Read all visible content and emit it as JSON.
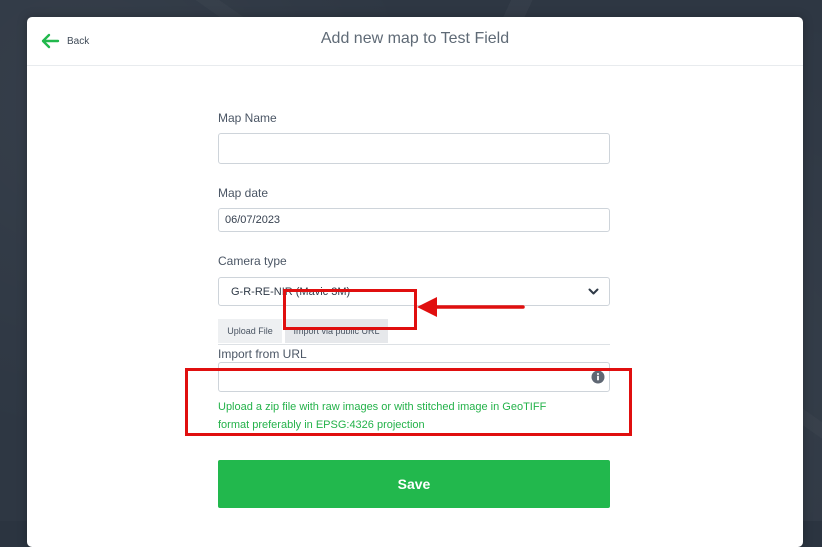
{
  "header": {
    "back_label": "Back",
    "title": "Add new map to Test Field"
  },
  "form": {
    "map_name": {
      "label": "Map Name",
      "value": ""
    },
    "map_date": {
      "label": "Map date",
      "value": "06/07/2023"
    },
    "camera_type": {
      "label": "Camera type",
      "selected": "G-R-RE-NIR (Mavic 3M)"
    },
    "tabs": [
      {
        "label": "Upload File",
        "active": false
      },
      {
        "label": "Import via public URL",
        "active": true
      }
    ],
    "import_url": {
      "label": "Import from URL",
      "value": ""
    },
    "help_text": {
      "line1": "Upload a zip file with raw images or with stitched image in GeoTIFF",
      "line2": "format preferably in EPSG:4326 projection"
    },
    "save_label": "Save"
  },
  "colors": {
    "accent_green": "#22b84d",
    "help_text_green": "#24b24a",
    "annotation_red": "#e00f0f"
  },
  "icons": {
    "back": "arrow-left-icon",
    "select_caret": "chevron-down-icon",
    "url_info": "info-icon"
  }
}
